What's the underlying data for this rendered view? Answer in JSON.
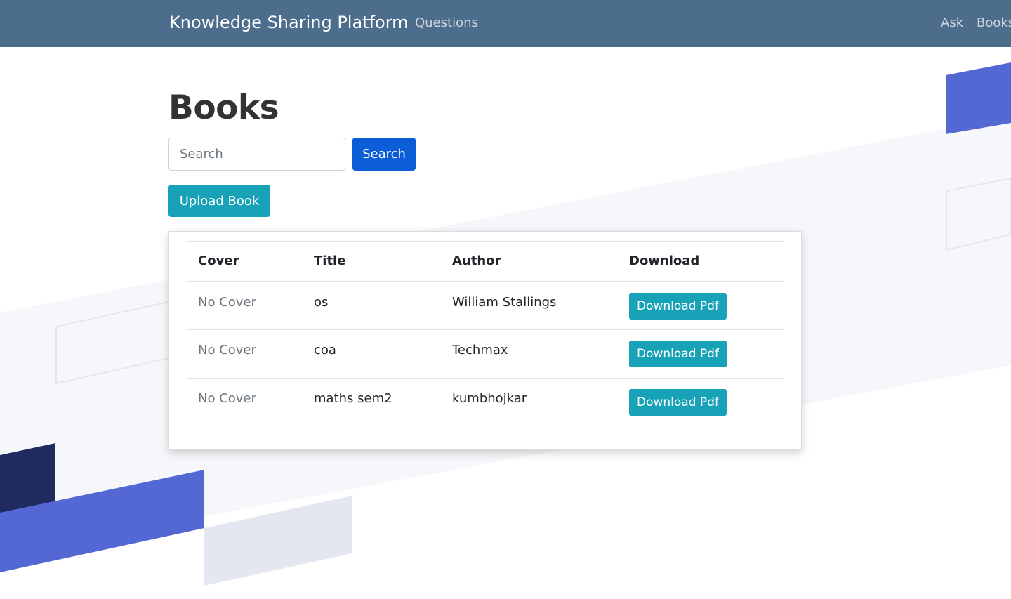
{
  "navbar": {
    "brand": "Knowledge Sharing Platform",
    "links": [
      "Questions",
      "Ask",
      "Books"
    ]
  },
  "page": {
    "title": "Books"
  },
  "search": {
    "placeholder": "Search",
    "value": "",
    "button_label": "Search"
  },
  "upload_label": "Upload Book",
  "table": {
    "headers": [
      "Cover",
      "Title",
      "Author",
      "Download"
    ],
    "rows": [
      {
        "cover": "No Cover",
        "title": "os",
        "author": "William Stallings",
        "download": "Download Pdf"
      },
      {
        "cover": "No Cover",
        "title": "coa",
        "author": "Techmax",
        "download": "Download Pdf"
      },
      {
        "cover": "No Cover",
        "title": "maths sem2",
        "author": "kumbhojkar",
        "download": "Download Pdf"
      }
    ]
  },
  "colors": {
    "navbar": "#4d6d8c",
    "primary": "#0b5ed7",
    "info": "#17a2b8",
    "accent_blue": "#5468d4",
    "accent_navy": "#1f2b5e",
    "accent_gray": "#e4e7ef"
  }
}
